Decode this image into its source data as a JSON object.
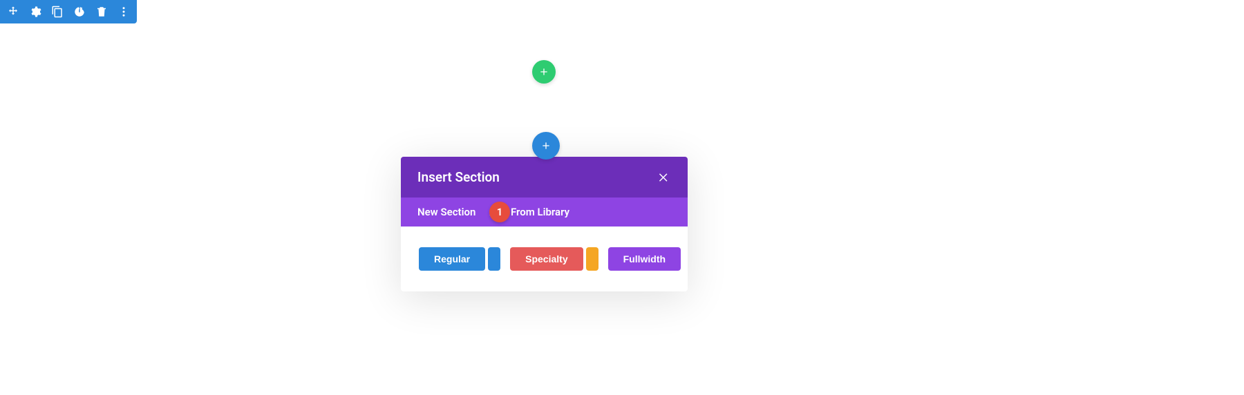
{
  "toolbar": {
    "move": "move",
    "settings": "settings",
    "duplicate": "duplicate",
    "save": "save",
    "delete": "delete",
    "more": "more"
  },
  "add_row_label": "+",
  "add_section_label": "+",
  "modal": {
    "title": "Insert Section",
    "close": "×",
    "tabs": {
      "new_section": "New Section",
      "add_from_library": "Add From Library"
    },
    "badge": "1",
    "section_types": {
      "regular": "Regular",
      "specialty": "Specialty",
      "fullwidth": "Fullwidth"
    }
  },
  "colors": {
    "toolbar_bg": "#2b87da",
    "add_row": "#2ecc71",
    "add_section": "#2b87da",
    "modal_header": "#6c2eb9",
    "modal_tabs": "#8e44e3",
    "badge": "#e74c3c",
    "regular_btn": "#2b87da",
    "specialty_btn": "#e55a5a",
    "fullwidth_btn": "#8e44e3",
    "chip_orange": "#f5a623"
  }
}
